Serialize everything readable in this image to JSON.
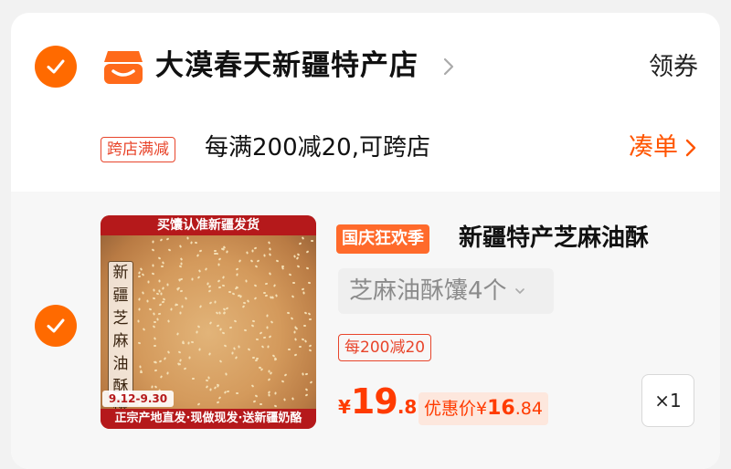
{
  "shop": {
    "name": "大漠春天新疆特产店",
    "coupon_label": "领券",
    "checked": true
  },
  "promotion": {
    "tag": "跨店满减",
    "text": "每满200减20,可跨店",
    "action": "凑单"
  },
  "item": {
    "checked": true,
    "thumbnail": {
      "top_banner": "买馕认准新疆发货",
      "vertical_text": "新疆芝麻油酥馕",
      "date": "9.12-9.30",
      "bottom_banner": "正宗产地直发·现做现发·送新疆奶酪"
    },
    "festival_badge": "国庆狂欢季",
    "title": "新疆特产芝麻油酥",
    "sku": "芝麻油酥馕4个",
    "promo_tag": "每200减20",
    "price": {
      "currency": "¥",
      "integer": "19",
      "decimal": ".8"
    },
    "discount": {
      "label": "优惠价",
      "currency": "¥",
      "integer": "16",
      "decimal": ".84"
    },
    "quantity": "×1"
  },
  "colors": {
    "accent": "#ff6a00",
    "price_red": "#ff3b00",
    "promo_red": "#e8452b",
    "thumb_banner": "#b5191b"
  },
  "icons": [
    "check-icon",
    "shop-logo-icon",
    "chevron-right-icon",
    "chevron-down-icon"
  ]
}
